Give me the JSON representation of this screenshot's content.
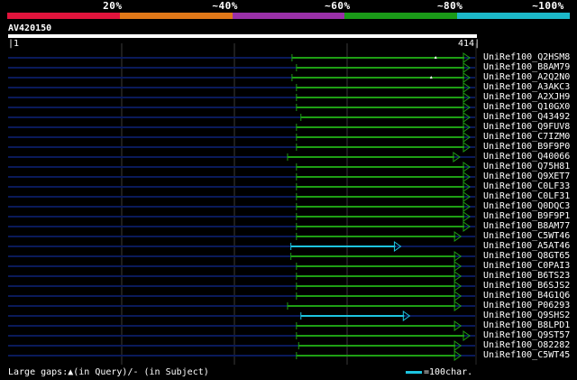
{
  "legend": {
    "segments": [
      {
        "label": "",
        "color": "#e0143c"
      },
      {
        "label": "20%",
        "color": "#e07818"
      },
      {
        "label": "~40%",
        "color": "#9a30a8"
      },
      {
        "label": "~60%",
        "color": "#1a9a18"
      },
      {
        "label": "~80%",
        "color": "#1cb8c8"
      }
    ],
    "labels": [
      "20%",
      "~40%",
      "~60%",
      "~80%",
      "~100%"
    ]
  },
  "query": {
    "id": "AV420150",
    "start": "1",
    "end": "414",
    "length": 414
  },
  "hits": [
    {
      "name": "UniRef100_Q2HSM8",
      "start": 256,
      "end": 414,
      "color": "green",
      "marks": [
        385
      ]
    },
    {
      "name": "UniRef100_B8AM79",
      "start": 260,
      "end": 414,
      "color": "green",
      "marks": []
    },
    {
      "name": "UniRef100_A2Q2N0",
      "start": 256,
      "end": 414,
      "color": "green",
      "marks": [
        381
      ]
    },
    {
      "name": "UniRef100_A3AKC3",
      "start": 260,
      "end": 414,
      "color": "green",
      "marks": []
    },
    {
      "name": "UniRef100_A2XJH9",
      "start": 260,
      "end": 414,
      "color": "green",
      "marks": []
    },
    {
      "name": "UniRef100_Q10GX0",
      "start": 260,
      "end": 414,
      "color": "green",
      "marks": []
    },
    {
      "name": "UniRef100_Q43492",
      "start": 264,
      "end": 414,
      "color": "green",
      "marks": []
    },
    {
      "name": "UniRef100_Q9FUV8",
      "start": 260,
      "end": 414,
      "color": "green",
      "marks": []
    },
    {
      "name": "UniRef100_C7IZM0",
      "start": 260,
      "end": 414,
      "color": "green",
      "marks": []
    },
    {
      "name": "UniRef100_B9F9P0",
      "start": 260,
      "end": 414,
      "color": "green",
      "marks": []
    },
    {
      "name": "UniRef100_Q40066",
      "start": 252,
      "end": 405,
      "color": "green",
      "marks": []
    },
    {
      "name": "UniRef100_Q75H81",
      "start": 260,
      "end": 414,
      "color": "green",
      "marks": []
    },
    {
      "name": "UniRef100_Q9XET7",
      "start": 260,
      "end": 414,
      "color": "green",
      "marks": []
    },
    {
      "name": "UniRef100_C0LF33",
      "start": 260,
      "end": 414,
      "color": "green",
      "marks": []
    },
    {
      "name": "UniRef100_C0LF31",
      "start": 260,
      "end": 414,
      "color": "green",
      "marks": []
    },
    {
      "name": "UniRef100_Q0DQC3",
      "start": 260,
      "end": 414,
      "color": "green",
      "marks": []
    },
    {
      "name": "UniRef100_B9F9P1",
      "start": 260,
      "end": 414,
      "color": "green",
      "marks": []
    },
    {
      "name": "UniRef100_B8AM77",
      "start": 260,
      "end": 414,
      "color": "green",
      "marks": []
    },
    {
      "name": "UniRef100_C5WT46",
      "start": 260,
      "end": 406,
      "color": "green",
      "marks": []
    },
    {
      "name": "UniRef100_A5AT46",
      "start": 255,
      "end": 352,
      "color": "cyan",
      "marks": []
    },
    {
      "name": "UniRef100_Q8GT65",
      "start": 255,
      "end": 406,
      "color": "green",
      "marks": []
    },
    {
      "name": "UniRef100_C0PAI3",
      "start": 260,
      "end": 406,
      "color": "green",
      "marks": []
    },
    {
      "name": "UniRef100_B6TS23",
      "start": 260,
      "end": 406,
      "color": "green",
      "marks": []
    },
    {
      "name": "UniRef100_B6SJS2",
      "start": 260,
      "end": 406,
      "color": "green",
      "marks": []
    },
    {
      "name": "UniRef100_B4G1Q6",
      "start": 260,
      "end": 406,
      "color": "green",
      "marks": []
    },
    {
      "name": "UniRef100_P06293",
      "start": 252,
      "end": 406,
      "color": "green",
      "marks": []
    },
    {
      "name": "UniRef100_Q9SHS2",
      "start": 264,
      "end": 360,
      "color": "cyan",
      "marks": []
    },
    {
      "name": "UniRef100_B8LPD1",
      "start": 260,
      "end": 406,
      "color": "green",
      "marks": []
    },
    {
      "name": "UniRef100_Q9ST57",
      "start": 260,
      "end": 414,
      "color": "green",
      "marks": []
    },
    {
      "name": "UniRef100_O82282",
      "start": 262,
      "end": 406,
      "color": "green",
      "marks": []
    },
    {
      "name": "UniRef100_C5WT45",
      "start": 260,
      "end": 406,
      "color": "green",
      "marks": []
    }
  ],
  "colors": {
    "green": "#1e9e14",
    "cyan": "#1cc4e0",
    "track": "#0a1a5a",
    "grid": "#3a3a3a",
    "gap_mark": "#ffffff"
  },
  "footer": {
    "gaps_text": "Large gaps:▲(in Query)/- (in Subject)",
    "scale_text": "=100char."
  }
}
